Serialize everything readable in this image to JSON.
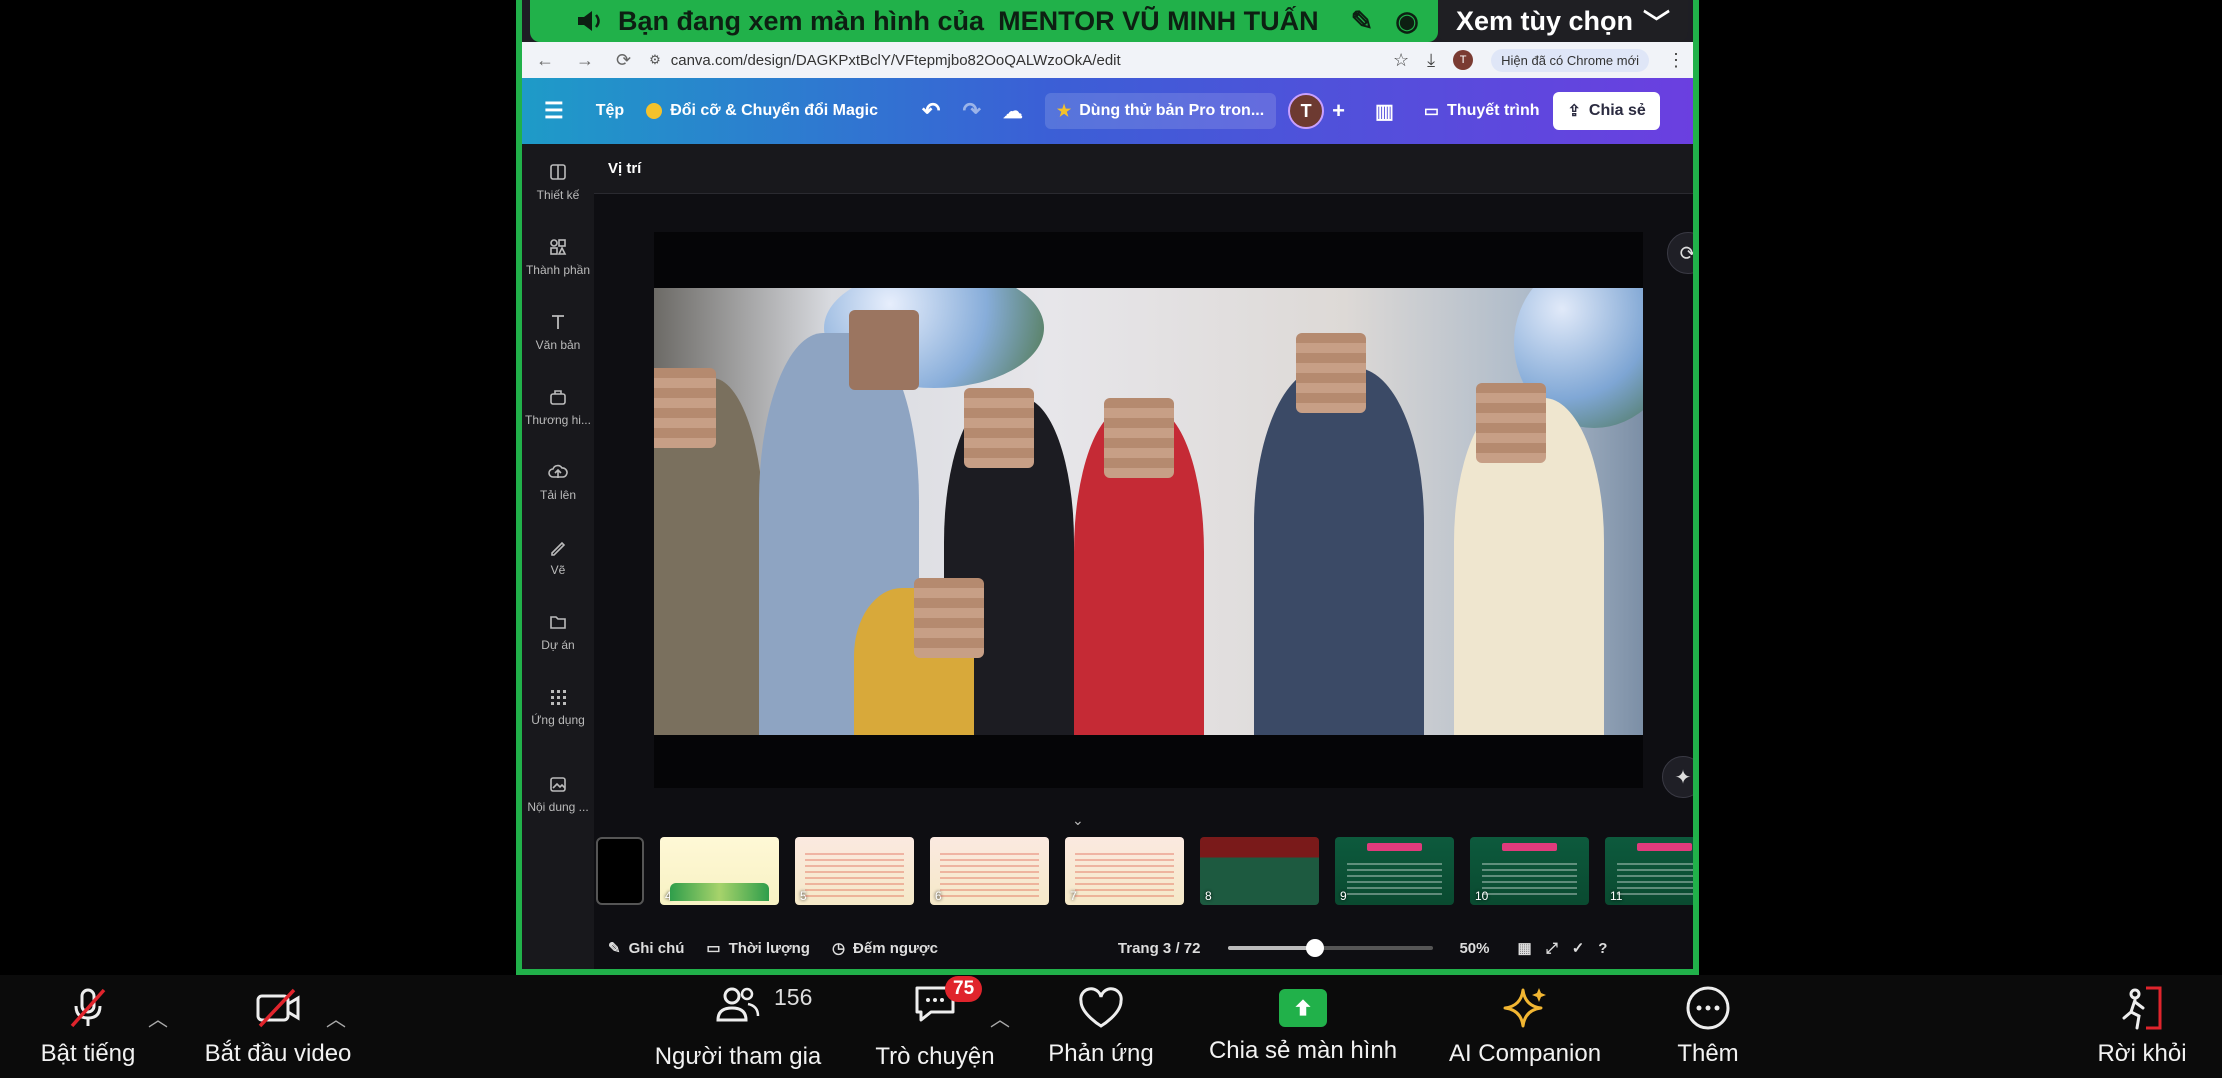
{
  "share_banner": {
    "text": "Bạn đang xem màn hình của",
    "presenter": "MENTOR VŨ MINH TUẤN",
    "options_label": "Xem tùy chọn"
  },
  "browser": {
    "url": "canva.com/design/DAGKPxtBclY/VFtepmjbo82OoQALWzoOkA/edit",
    "profile_initial": "T",
    "update_note": "Hiện đã có Chrome mới"
  },
  "canva": {
    "menu_file": "Tệp",
    "magic_resize": "Đổi cỡ & Chuyển đổi Magic",
    "pro_trial": "Dùng thử bản Pro tron...",
    "user_initial": "T",
    "present_label": "Thuyết trình",
    "share_label": "Chia sẻ",
    "position_label": "Vị trí",
    "rail": [
      {
        "label": "Thiết kế",
        "icon": "layout-icon"
      },
      {
        "label": "Thành phần",
        "icon": "elements-icon"
      },
      {
        "label": "Văn bản",
        "icon": "text-icon"
      },
      {
        "label": "Thương hi...",
        "icon": "brand-icon"
      },
      {
        "label": "Tải lên",
        "icon": "upload-icon"
      },
      {
        "label": "Vẽ",
        "icon": "draw-icon"
      },
      {
        "label": "Dự án",
        "icon": "folder-icon"
      },
      {
        "label": "Ứng dụng",
        "icon": "apps-icon"
      },
      {
        "label": "Nội dung ...",
        "icon": "media-icon"
      }
    ],
    "thumbnails": [
      {
        "num": "",
        "style": "first"
      },
      {
        "num": "4",
        "style": "yellow"
      },
      {
        "num": "5",
        "style": "pastel"
      },
      {
        "num": "6",
        "style": "pastel"
      },
      {
        "num": "7",
        "style": "pastel"
      },
      {
        "num": "8",
        "style": "redgreen"
      },
      {
        "num": "9",
        "style": "green"
      },
      {
        "num": "10",
        "style": "green"
      },
      {
        "num": "11",
        "style": "green"
      }
    ],
    "footer": {
      "notes": "Ghi chú",
      "duration": "Thời lượng",
      "countdown": "Đếm ngược",
      "page": "Trang 3 / 72",
      "zoom": "50%",
      "zoom_fraction": 0.42
    }
  },
  "zoom_controls": {
    "unmute": "Bật tiếng",
    "start_video": "Bắt đầu video",
    "participants": "Người tham gia",
    "participants_count": "156",
    "chat": "Trò chuyện",
    "chat_badge": "75",
    "reactions": "Phản ứng",
    "share_screen": "Chia sẻ màn hình",
    "ai_companion": "AI Companion",
    "more": "Thêm",
    "leave": "Rời khỏi"
  },
  "colors": {
    "share_green": "#21b14a",
    "badge_red": "#e0242c",
    "leave_red": "#e0242c"
  }
}
